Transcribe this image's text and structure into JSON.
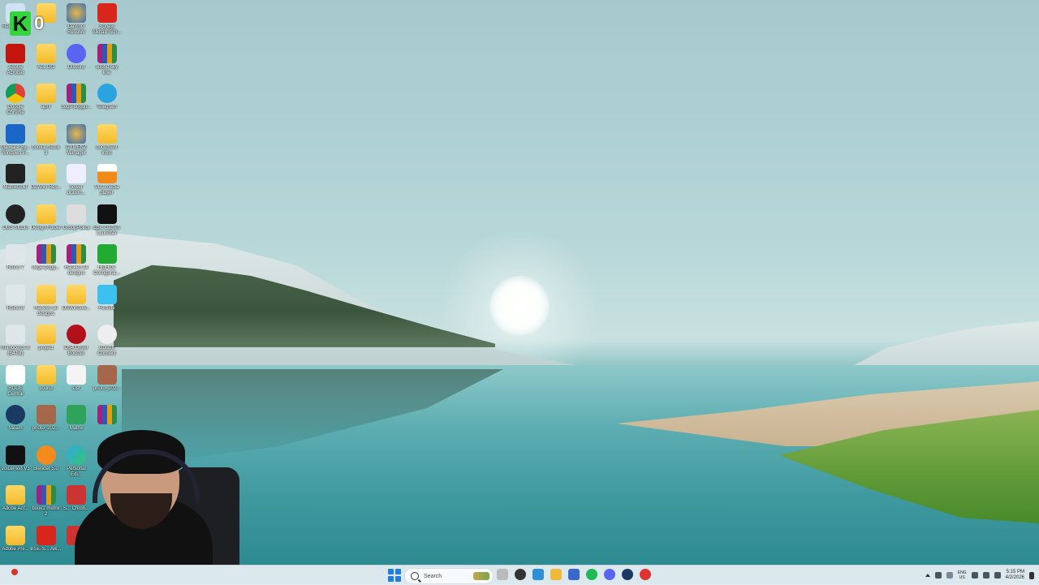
{
  "desktop": {
    "icons": [
      {
        "label": "Recycle Bin",
        "icon": "recycle-bin-icon",
        "col": 0,
        "row": 0
      },
      {
        "label": "",
        "icon": "folder-icon",
        "col": 1,
        "row": 0
      },
      {
        "label": "DaVinci Resolve",
        "icon": "davinci-icon",
        "col": 2,
        "row": 0
      },
      {
        "label": "Sohayl Alkhalil Sch...",
        "icon": "pdf-icon",
        "col": 3,
        "row": 0
      },
      {
        "label": "Adobe Acrobat",
        "icon": "acrobat-icon",
        "col": 0,
        "row": 1
      },
      {
        "label": "ALL DO",
        "icon": "folder-icon",
        "col": 1,
        "row": 1
      },
      {
        "label": "Discord",
        "icon": "discord-icon",
        "col": 2,
        "row": 1
      },
      {
        "label": "sound sky line",
        "icon": "rar-icon",
        "col": 3,
        "row": 1
      },
      {
        "label": "Google Chrome",
        "icon": "chrome-icon",
        "col": 0,
        "row": 2
      },
      {
        "label": "april",
        "icon": "folder-icon",
        "col": 1,
        "row": 2
      },
      {
        "label": "doge-poggo...",
        "icon": "rar-icon",
        "col": 2,
        "row": 2
      },
      {
        "label": "Telegram",
        "icon": "telegram-icon",
        "col": 3,
        "row": 2
      },
      {
        "label": "Malware By... Windows F...",
        "icon": "checkbox-app-icon",
        "col": 0,
        "row": 3
      },
      {
        "label": "book1 metrix 3",
        "icon": "folder-icon",
        "col": 1,
        "row": 3
      },
      {
        "label": "DYMENZ Manager",
        "icon": "davinci-icon",
        "col": 2,
        "row": 3
      },
      {
        "label": "document intro",
        "icon": "folder-icon",
        "col": 3,
        "row": 3
      },
      {
        "label": "MatrixGold",
        "icon": "matrixgold-icon",
        "col": 0,
        "row": 4
      },
      {
        "label": "DaVinci Res...",
        "icon": "folder-icon",
        "col": 1,
        "row": 4
      },
      {
        "label": "flower drawin...",
        "icon": "image-icon",
        "col": 2,
        "row": 4
      },
      {
        "label": "VLC media player",
        "icon": "vlc-icon",
        "col": 3,
        "row": 4
      },
      {
        "label": "OBS Studio",
        "icon": "obs-icon",
        "col": 0,
        "row": 5
      },
      {
        "label": "Design Folder",
        "icon": "folder-icon",
        "col": 1,
        "row": 5
      },
      {
        "label": "GroupPolicy",
        "icon": "gear-icon",
        "col": 2,
        "row": 5
      },
      {
        "label": "Epic Games Launcher",
        "icon": "epic-icon",
        "col": 3,
        "row": 5
      },
      {
        "label": "Rhino 7",
        "icon": "rhino-icon",
        "col": 0,
        "row": 6
      },
      {
        "label": "doge-pogg...",
        "icon": "rar-icon",
        "col": 1,
        "row": 6
      },
      {
        "label": "Haneen all designs",
        "icon": "rar-icon",
        "col": 2,
        "row": 6
      },
      {
        "label": "HidHide Configurat...",
        "icon": "hidhide-icon",
        "col": 3,
        "row": 6
      },
      {
        "label": "Rhino 8",
        "icon": "rhino-icon",
        "col": 0,
        "row": 7
      },
      {
        "label": "Haneen all designs",
        "icon": "folder-icon",
        "col": 1,
        "row": 7
      },
      {
        "label": "DSWindow...",
        "icon": "folder-icon",
        "col": 2,
        "row": 7
      },
      {
        "label": "Fortnite",
        "icon": "fortnite-icon",
        "col": 3,
        "row": 7
      },
      {
        "label": "Rhinoceros 8 (64-bit)",
        "icon": "rhino-icon",
        "col": 0,
        "row": 8
      },
      {
        "label": "project",
        "icon": "folder-icon",
        "col": 1,
        "row": 8
      },
      {
        "label": "DS4 Driver Booster",
        "icon": "booster-icon",
        "col": 2,
        "row": 8
      },
      {
        "label": "Ubisoft Connect",
        "icon": "ubisoft-icon",
        "col": 3,
        "row": 8
      },
      {
        "label": "RODE Central",
        "icon": "rode-icon",
        "col": 0,
        "row": 9
      },
      {
        "label": "sound",
        "icon": "folder-icon",
        "col": 1,
        "row": 9
      },
      {
        "label": "List",
        "icon": "text-file-icon",
        "col": 2,
        "row": 9
      },
      {
        "label": "photo_202...",
        "icon": "photo-icon",
        "col": 3,
        "row": 9
      },
      {
        "label": "Steam",
        "icon": "steam-icon",
        "col": 0,
        "row": 10
      },
      {
        "label": "photo_202...",
        "icon": "photo-icon",
        "col": 1,
        "row": 10
      },
      {
        "label": "Matrix",
        "icon": "matrix-icon",
        "col": 2,
        "row": 10
      },
      {
        "label": "",
        "icon": "rar-icon",
        "col": 3,
        "row": 10
      },
      {
        "label": "Voicemod V3",
        "icon": "voicemod-icon",
        "col": 0,
        "row": 11
      },
      {
        "label": "Blender 5.0",
        "icon": "blender-icon",
        "col": 1,
        "row": 11
      },
      {
        "label": "Personal Edi...",
        "icon": "edge-icon",
        "col": 2,
        "row": 11
      },
      {
        "label": "Adobe Acr...",
        "icon": "folder-icon",
        "col": 0,
        "row": 12
      },
      {
        "label": "book1 metrix 2",
        "icon": "rar-icon",
        "col": 1,
        "row": 12
      },
      {
        "label": "S... Chron...",
        "icon": "app-icon",
        "col": 2,
        "row": 12
      },
      {
        "label": "Adobe Pre...",
        "icon": "folder-icon",
        "col": 0,
        "row": 13
      },
      {
        "label": "BSE-S... Alk...",
        "icon": "pdf-icon",
        "col": 1,
        "row": 13
      },
      {
        "label": "",
        "icon": "app-icon",
        "col": 2,
        "row": 13
      }
    ]
  },
  "overlay": {
    "badge_letter": "K",
    "badge_count": "0"
  },
  "taskbar": {
    "search_placeholder": "Search",
    "apps": [
      "file-icon",
      "obs-icon",
      "edge-icon",
      "explorer-icon",
      "store-icon",
      "spotify-icon",
      "discord-icon",
      "steam-icon",
      "chrome-icon"
    ],
    "lang_top": "ENG",
    "lang_bottom": "US",
    "time": "5:15 PM",
    "date": "4/2/2026"
  },
  "colors": {
    "accent": "#1f7ee0",
    "badge": "#35d43f"
  }
}
